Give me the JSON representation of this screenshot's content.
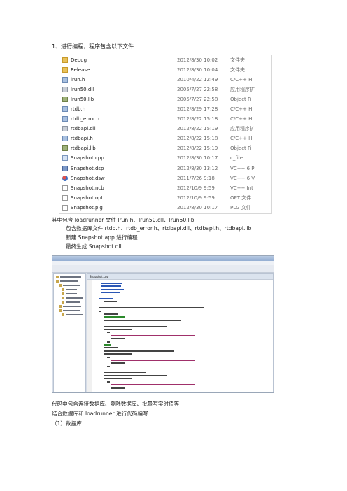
{
  "heading": "1、进行编程，程序包含以下文件",
  "files": [
    {
      "name": "Debug",
      "date": "2012/8/30 10:02",
      "type": "文件夹",
      "icon": "folder-icon"
    },
    {
      "name": "Release",
      "date": "2012/8/30 10:04",
      "type": "文件夹",
      "icon": "folder-icon"
    },
    {
      "name": "lrun.h",
      "date": "2010/4/22 12:49",
      "type": "C/C++ H",
      "icon": "header-file-icon"
    },
    {
      "name": "lrun50.dll",
      "date": "2005/7/27 22:58",
      "type": "应用程序扩",
      "icon": "dll-file-icon"
    },
    {
      "name": "lrun50.lib",
      "date": "2005/7/27 22:58",
      "type": "Object Fi",
      "icon": "lib-file-icon"
    },
    {
      "name": "rtdb.h",
      "date": "2012/8/29 17:28",
      "type": "C/C++ H",
      "icon": "header-file-icon"
    },
    {
      "name": "rtdb_error.h",
      "date": "2012/8/22 15:18",
      "type": "C/C++ H",
      "icon": "header-file-icon"
    },
    {
      "name": "rtdbapi.dll",
      "date": "2012/8/22 15:19",
      "type": "应用程序扩",
      "icon": "dll-file-icon"
    },
    {
      "name": "rtdbapi.h",
      "date": "2012/8/22 15:18",
      "type": "C/C++ H",
      "icon": "header-file-icon"
    },
    {
      "name": "rtdbapi.lib",
      "date": "2012/8/22 15:19",
      "type": "Object Fi",
      "icon": "lib-file-icon"
    },
    {
      "name": "Snapshot.cpp",
      "date": "2012/8/30 10:17",
      "type": "c_file",
      "icon": "cpp-file-icon"
    },
    {
      "name": "Snapshot.dsp",
      "date": "2012/8/30 13:12",
      "type": "VC++ 6 P",
      "icon": "dsp-file-icon"
    },
    {
      "name": "Snapshot.dsw",
      "date": "2011/7/26 9:18",
      "type": "VC++ 6 V",
      "icon": "dsw-file-icon"
    },
    {
      "name": "Snapshot.ncb",
      "date": "2012/10/9 9:59",
      "type": "VC++ Int",
      "icon": "text-file-icon"
    },
    {
      "name": "Snapshot.opt",
      "date": "2012/10/9 9:59",
      "type": "OPT 文件",
      "icon": "text-file-icon"
    },
    {
      "name": "Snapshot.plg",
      "date": "2012/8/30 10:17",
      "type": "PLG 文件",
      "icon": "text-file-icon"
    },
    {
      "name": "StdAfx.h",
      "date": "2010/10/9 12:13",
      "type": "C/C++ H",
      "icon": "header-file-icon"
    }
  ],
  "lines": {
    "l1": "其中包含 loadrunner 文件 lrun.h、lrun50.dll、lrun50.lib",
    "l2": "包含数据库文件 rtdb.h、rtdb_error.h、rtdbapi.dll、rtdbapi.h、rtdbapi.lib",
    "l3": "新建 Snapshot.app 进行编程",
    "l4": "最终生成 Snapshot.dll",
    "l5": "代码中包含连接数据库、登陆数据库、批量写实时值等",
    "l6": "结合数据库和 loadrunner 进行代码编写",
    "l7": "（1）数据库"
  },
  "ide": {
    "title": "Snapshot - Microsoft Visual C++",
    "editor_tab": "Snapshot.cpp",
    "tree": [
      "Workspace 'Snapshot'",
      "Snapshot files",
      "Header Files",
      "lrun.h",
      "rtdb.h",
      "rtdb_error.h",
      "rtdbapi.h",
      "Resource Files",
      "Source Files",
      "Snapshot.cpp"
    ]
  }
}
